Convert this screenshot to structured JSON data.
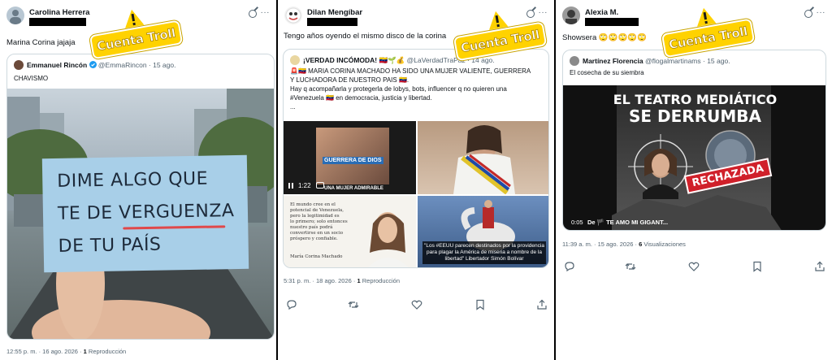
{
  "colors": {
    "sticker_yellow": "#ffd200",
    "link": "#536471",
    "verified": "#1d9bf0",
    "redaction": "#000000"
  },
  "sticker": {
    "label": "Cuenta Troll",
    "icon": "warning-triangle-icon"
  },
  "tweets": [
    {
      "user_name": "Carolina Herrera",
      "text": "Marina Corina jajaja",
      "quote": {
        "name": "Emmanuel Rincón",
        "verified": true,
        "meta": "@EmmaRincon · 15 ago.",
        "text": "CHAVISMO"
      },
      "sign_lines": [
        "DIME ALGO QUE",
        "TE DE VERGUENZA",
        "DE TU PAÍS"
      ],
      "timestamp": "12:55 p. m. · 16 ago. 2026 ·",
      "views_count": "1",
      "views_label": "Reproducción"
    },
    {
      "user_name": "Dilan Mengíbar",
      "text": "Tengo años oyendo el mismo disco de la corina",
      "quote": {
        "name": "¡VERDAD INCÓMODA! 🇻🇪🌱💰",
        "meta": "@LaVerdadTraPaz · 14 ago.",
        "text_lines": [
          "🚨🇻🇪 MARIA CORINA MACHADO HA SIDO UNA MUJER VALIENTE, GUERRERA",
          "Y LUCHADORA DE NUESTRO PAIS 🇻🇪.",
          "Hay q acompañarla y protegerla de lobys, bots, influencer q no quieren una",
          "#Venezuela 🇻🇪 en democracia, justicia y libertad.",
          "..."
        ]
      },
      "media": {
        "video_time": "1:22",
        "video_caption": "GUERRERA DE DIOS",
        "video_caption2": "UNA MUJER ADMIRABLE",
        "quote_card_lines": [
          "El mundo cree en el",
          "potencial de Venezuela,",
          "pero la legitimidad es",
          "lo primero; solo entonces",
          "nuestro país podrá",
          "convertirse en un socio",
          "próspero y confiable."
        ],
        "quote_card_author": "María Corina Machado",
        "bolivar_caption": "\"Los #EEUU parecen destinados por la providencia para plagar la América de miseria a nombre de la libertad\" Libertador Simón Bolívar"
      },
      "timestamp": "5:31 p. m. · 18 ago. 2026 ·",
      "views_count": "1",
      "views_label": "Reproducción"
    },
    {
      "user_name": "Alexia M.",
      "text": "Showsera 🙄🙄🙄🙄🙄",
      "quote": {
        "name": "Martínez Florencia",
        "meta": "@flogalmartinams · 15 ago.",
        "text": "El cosecha de su siembra"
      },
      "poster": {
        "title1": "EL TEATRO MEDIÁTICO",
        "title2": "SE DERRUMBA",
        "stamp": "RECHAZADA",
        "video_time": "0:05",
        "video_label": "De 🏴 TE AMO MI GIGANT..."
      },
      "timestamp": "11:39 a. m. · 15 ago. 2026 ·",
      "views_count": "6",
      "views_label": "Visualizaciones"
    }
  ]
}
